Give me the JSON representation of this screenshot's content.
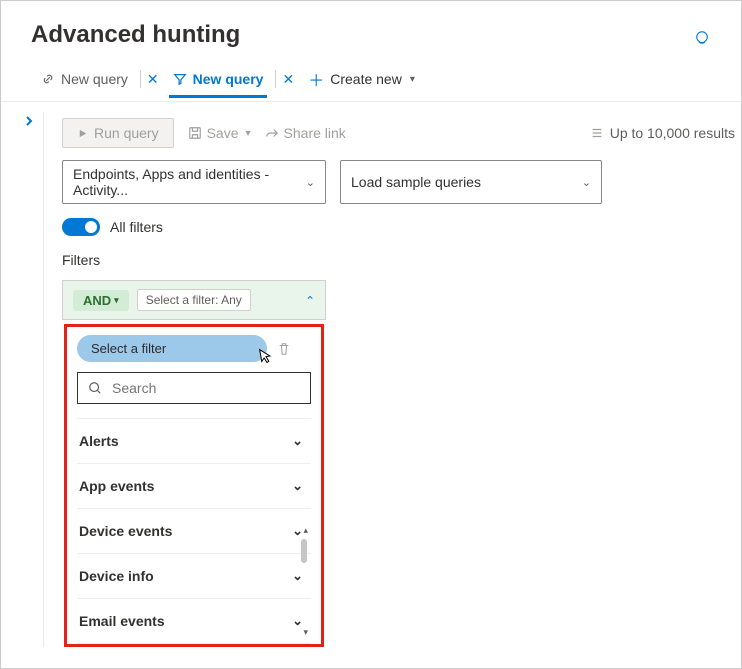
{
  "header": {
    "title": "Advanced hunting"
  },
  "tabs": {
    "items": [
      {
        "label": "New query",
        "active": false
      },
      {
        "label": "New query",
        "active": true
      }
    ],
    "create_label": "Create new"
  },
  "toolbar": {
    "run_label": "Run query",
    "save_label": "Save",
    "share_label": "Share link",
    "results_note": "Up to 10,000 results"
  },
  "dropdowns": {
    "source_label": "Endpoints, Apps and identities - Activity...",
    "sample_label": "Load sample queries"
  },
  "toggle": {
    "label": "All filters"
  },
  "filters": {
    "heading": "Filters",
    "and_label": "AND",
    "tooltip": "Select a filter: Any",
    "select_pill": "Select a filter",
    "search_placeholder": "Search",
    "categories": [
      "Alerts",
      "App events",
      "Device events",
      "Device info",
      "Email events"
    ]
  }
}
